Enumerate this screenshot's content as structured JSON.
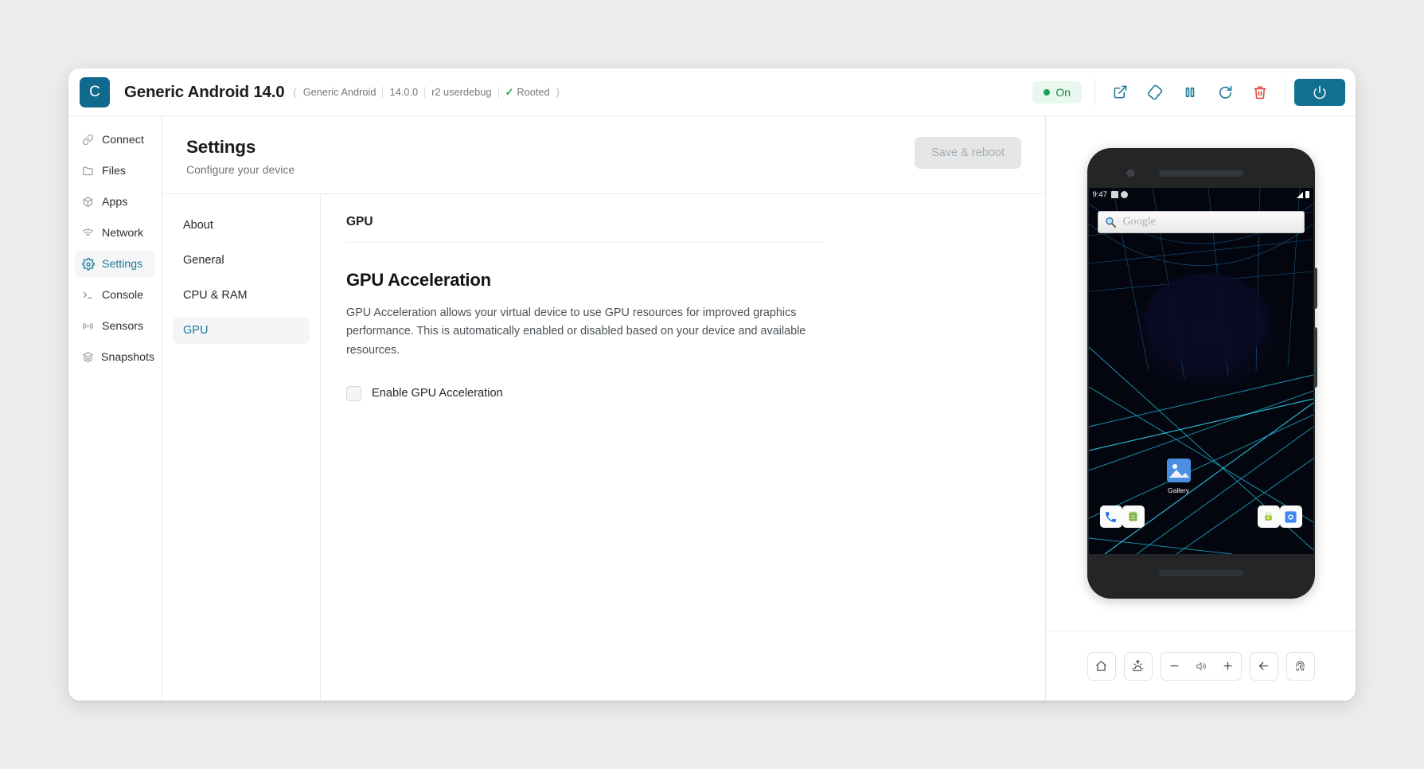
{
  "header": {
    "logo_letter": "C",
    "device_title": "Generic Android 14.0",
    "meta": {
      "open_paren": "(",
      "close_paren": ")",
      "device_name": "Generic Android",
      "version": "14.0.0",
      "build": "r2 userdebug",
      "rooted": "Rooted",
      "check_glyph": "✓"
    },
    "status": {
      "label": "On",
      "color": "#19a155",
      "bg": "#e9f8ef"
    },
    "toolbar": [
      {
        "name": "open-external-button",
        "title": "Open external"
      },
      {
        "name": "rotate-device-button",
        "title": "Rotate"
      },
      {
        "name": "pause-button",
        "title": "Pause"
      },
      {
        "name": "restart-button",
        "title": "Restart"
      },
      {
        "name": "delete-button",
        "title": "Delete",
        "color": "#e03b3b"
      }
    ],
    "power_button": {
      "name": "power-button",
      "title": "Power",
      "color": "#11708f"
    },
    "accent": "#1b7a96"
  },
  "sidebar": {
    "items": [
      {
        "label": "Connect",
        "icon": "link-icon",
        "active": false
      },
      {
        "label": "Files",
        "icon": "folder-icon",
        "active": false
      },
      {
        "label": "Apps",
        "icon": "cube-icon",
        "active": false
      },
      {
        "label": "Network",
        "icon": "wifi-icon",
        "active": false
      },
      {
        "label": "Settings",
        "icon": "gear-icon",
        "active": true
      },
      {
        "label": "Console",
        "icon": "terminal-icon",
        "active": false
      },
      {
        "label": "Sensors",
        "icon": "sensor-icon",
        "active": false
      },
      {
        "label": "Snapshots",
        "icon": "layers-icon",
        "active": false
      }
    ]
  },
  "page": {
    "title": "Settings",
    "subtitle": "Configure your device",
    "save_label": "Save & reboot",
    "save_disabled": true
  },
  "subnav": {
    "items": [
      {
        "label": "About",
        "active": false
      },
      {
        "label": "General",
        "active": false
      },
      {
        "label": "CPU & RAM",
        "active": false
      },
      {
        "label": "GPU",
        "active": true
      }
    ]
  },
  "detail": {
    "section_label": "GPU",
    "section_title": "GPU Acceleration",
    "description": "GPU Acceleration allows your virtual device to use GPU resources for improved graphics performance. This is automatically enabled or disabled based on your device and available resources.",
    "checkbox_label": "Enable GPU Acceleration",
    "checkbox_checked": false
  },
  "device_preview": {
    "status_time": "9:47",
    "search_placeholder": "Google",
    "gallery_label": "Gallery",
    "dock_apps": [
      "phone-icon",
      "messaging-icon",
      "apps-icon",
      "camera-icon"
    ],
    "controls": [
      {
        "name": "home-button",
        "title": "Home"
      },
      {
        "name": "brightness-button",
        "title": "Brightness"
      },
      {
        "name": "volume-down-button",
        "title": "Volume down"
      },
      {
        "name": "volume-icon",
        "title": "Volume"
      },
      {
        "name": "volume-up-button",
        "title": "Volume up"
      },
      {
        "name": "back-button",
        "title": "Back"
      },
      {
        "name": "fingerprint-button",
        "title": "Fingerprint"
      }
    ]
  }
}
